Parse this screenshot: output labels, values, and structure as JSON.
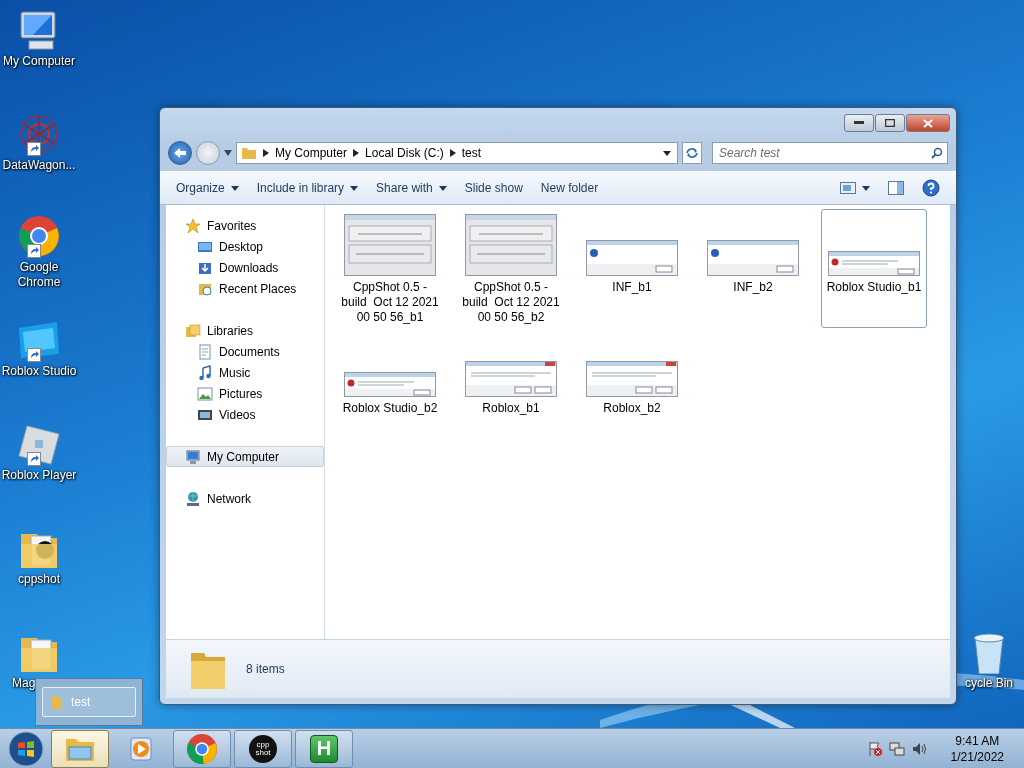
{
  "desktop_icons": [
    {
      "label": "My Computer",
      "shortcut": false
    },
    {
      "label": "DataWagon...",
      "shortcut": true
    },
    {
      "label": "Google Chrome",
      "shortcut": true
    },
    {
      "label": "Roblox Studio",
      "shortcut": true
    },
    {
      "label": "Roblox Player",
      "shortcut": true
    },
    {
      "label": "cppshot",
      "shortcut": false
    },
    {
      "label": "Mag",
      "shortcut": false
    },
    {
      "label": "cycle Bin",
      "shortcut": false
    }
  ],
  "window": {
    "breadcrumb": [
      "My Computer",
      "Local Disk (C:)",
      "test"
    ],
    "search": {
      "placeholder": "Search test"
    },
    "toolbar": [
      {
        "label": "Organize",
        "dropdown": true
      },
      {
        "label": "Include in library",
        "dropdown": true
      },
      {
        "label": "Share with",
        "dropdown": true
      },
      {
        "label": "Slide show",
        "dropdown": false
      },
      {
        "label": "New folder",
        "dropdown": false
      }
    ],
    "sidebar": [
      {
        "label": "Favorites",
        "selected": false,
        "children": [
          {
            "label": "Desktop",
            "selected": false
          },
          {
            "label": "Downloads",
            "selected": false
          },
          {
            "label": "Recent Places",
            "selected": false
          }
        ]
      },
      {
        "label": "Libraries",
        "selected": false,
        "children": [
          {
            "label": "Documents",
            "selected": false
          },
          {
            "label": "Music",
            "selected": false
          },
          {
            "label": "Pictures",
            "selected": false
          },
          {
            "label": "Videos",
            "selected": false
          }
        ]
      },
      {
        "label": "My Computer",
        "selected": true
      },
      {
        "label": "Network",
        "selected": false
      }
    ],
    "files": [
      {
        "name": "CppShot 0.5 - build  Oct 12 2021 00 50 56_b1",
        "kind": "tall",
        "selected": false
      },
      {
        "name": "CppShot 0.5 - build  Oct 12 2021 00 50 56_b2",
        "kind": "tall",
        "selected": false
      },
      {
        "name": "INF_b1",
        "kind": "info",
        "selected": false
      },
      {
        "name": "INF_b2",
        "kind": "info",
        "selected": false
      },
      {
        "name": "Roblox Studio_b1",
        "kind": "error",
        "selected": true
      },
      {
        "name": "Roblox Studio_b2",
        "kind": "error",
        "selected": false
      },
      {
        "name": "Roblox_b1",
        "kind": "wide",
        "selected": false
      },
      {
        "name": "Roblox_b2",
        "kind": "wide",
        "selected": false
      }
    ],
    "status": "8 items"
  },
  "preview": {
    "label": "test"
  },
  "taskbar": [
    {
      "running": true,
      "active": true
    },
    {
      "running": false,
      "active": false
    },
    {
      "running": true,
      "active": false
    },
    {
      "label": "cpp shot",
      "running": true,
      "active": false
    },
    {
      "label": "H",
      "running": true,
      "active": false
    }
  ],
  "clock": {
    "time": "9:41 AM",
    "date": "1/21/2022"
  }
}
